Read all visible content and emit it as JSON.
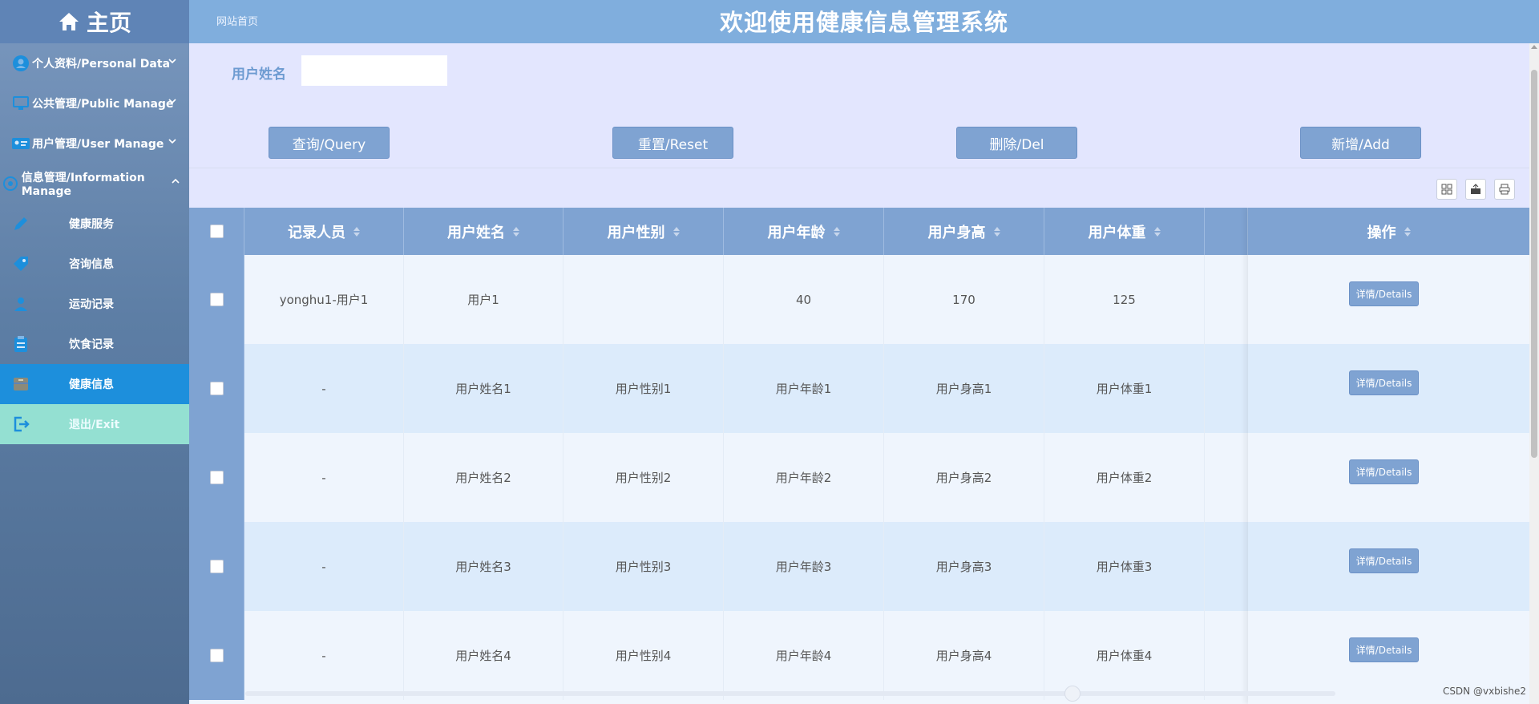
{
  "sidebar": {
    "brand": "主页",
    "groups": [
      {
        "label": "个人资料/Personal Data"
      },
      {
        "label": "公共管理/Public Manage"
      },
      {
        "label": "用户管理/User Manage"
      },
      {
        "label": "信息管理/Information Manage"
      }
    ],
    "items": [
      {
        "label": "健康服务"
      },
      {
        "label": "咨询信息"
      },
      {
        "label": "运动记录"
      },
      {
        "label": "饮食记录"
      },
      {
        "label": "健康信息"
      },
      {
        "label": "退出/Exit"
      }
    ]
  },
  "header": {
    "breadcrumb": "网站首页",
    "title": "欢迎使用健康信息管理系统"
  },
  "filter": {
    "label": "用户姓名",
    "value": "",
    "buttons": {
      "query": "查询/Query",
      "reset": "重置/Reset",
      "del": "删除/Del",
      "add": "新增/Add"
    }
  },
  "table": {
    "headers": [
      "记录人员",
      "用户姓名",
      "用户性别",
      "用户年龄",
      "用户身高",
      "用户体重",
      "操作"
    ],
    "rows": [
      [
        "yonghu1-用户1",
        "用户1",
        "",
        "40",
        "170",
        "125"
      ],
      [
        "-",
        "用户姓名1",
        "用户性别1",
        "用户年龄1",
        "用户身高1",
        "用户体重1"
      ],
      [
        "-",
        "用户姓名2",
        "用户性别2",
        "用户年龄2",
        "用户身高2",
        "用户体重2"
      ],
      [
        "-",
        "用户姓名3",
        "用户性别3",
        "用户年龄3",
        "用户身高3",
        "用户体重3"
      ],
      [
        "-",
        "用户姓名4",
        "用户性别4",
        "用户年龄4",
        "用户身高4",
        "用户体重4"
      ]
    ],
    "details_label": "详情/Details"
  },
  "watermark": "CSDN @vxbishe2",
  "colors": {
    "primary": "#7fa3d2",
    "active": "#1d8fdc",
    "exit": "#94e0d2",
    "header": "#80aedd"
  }
}
